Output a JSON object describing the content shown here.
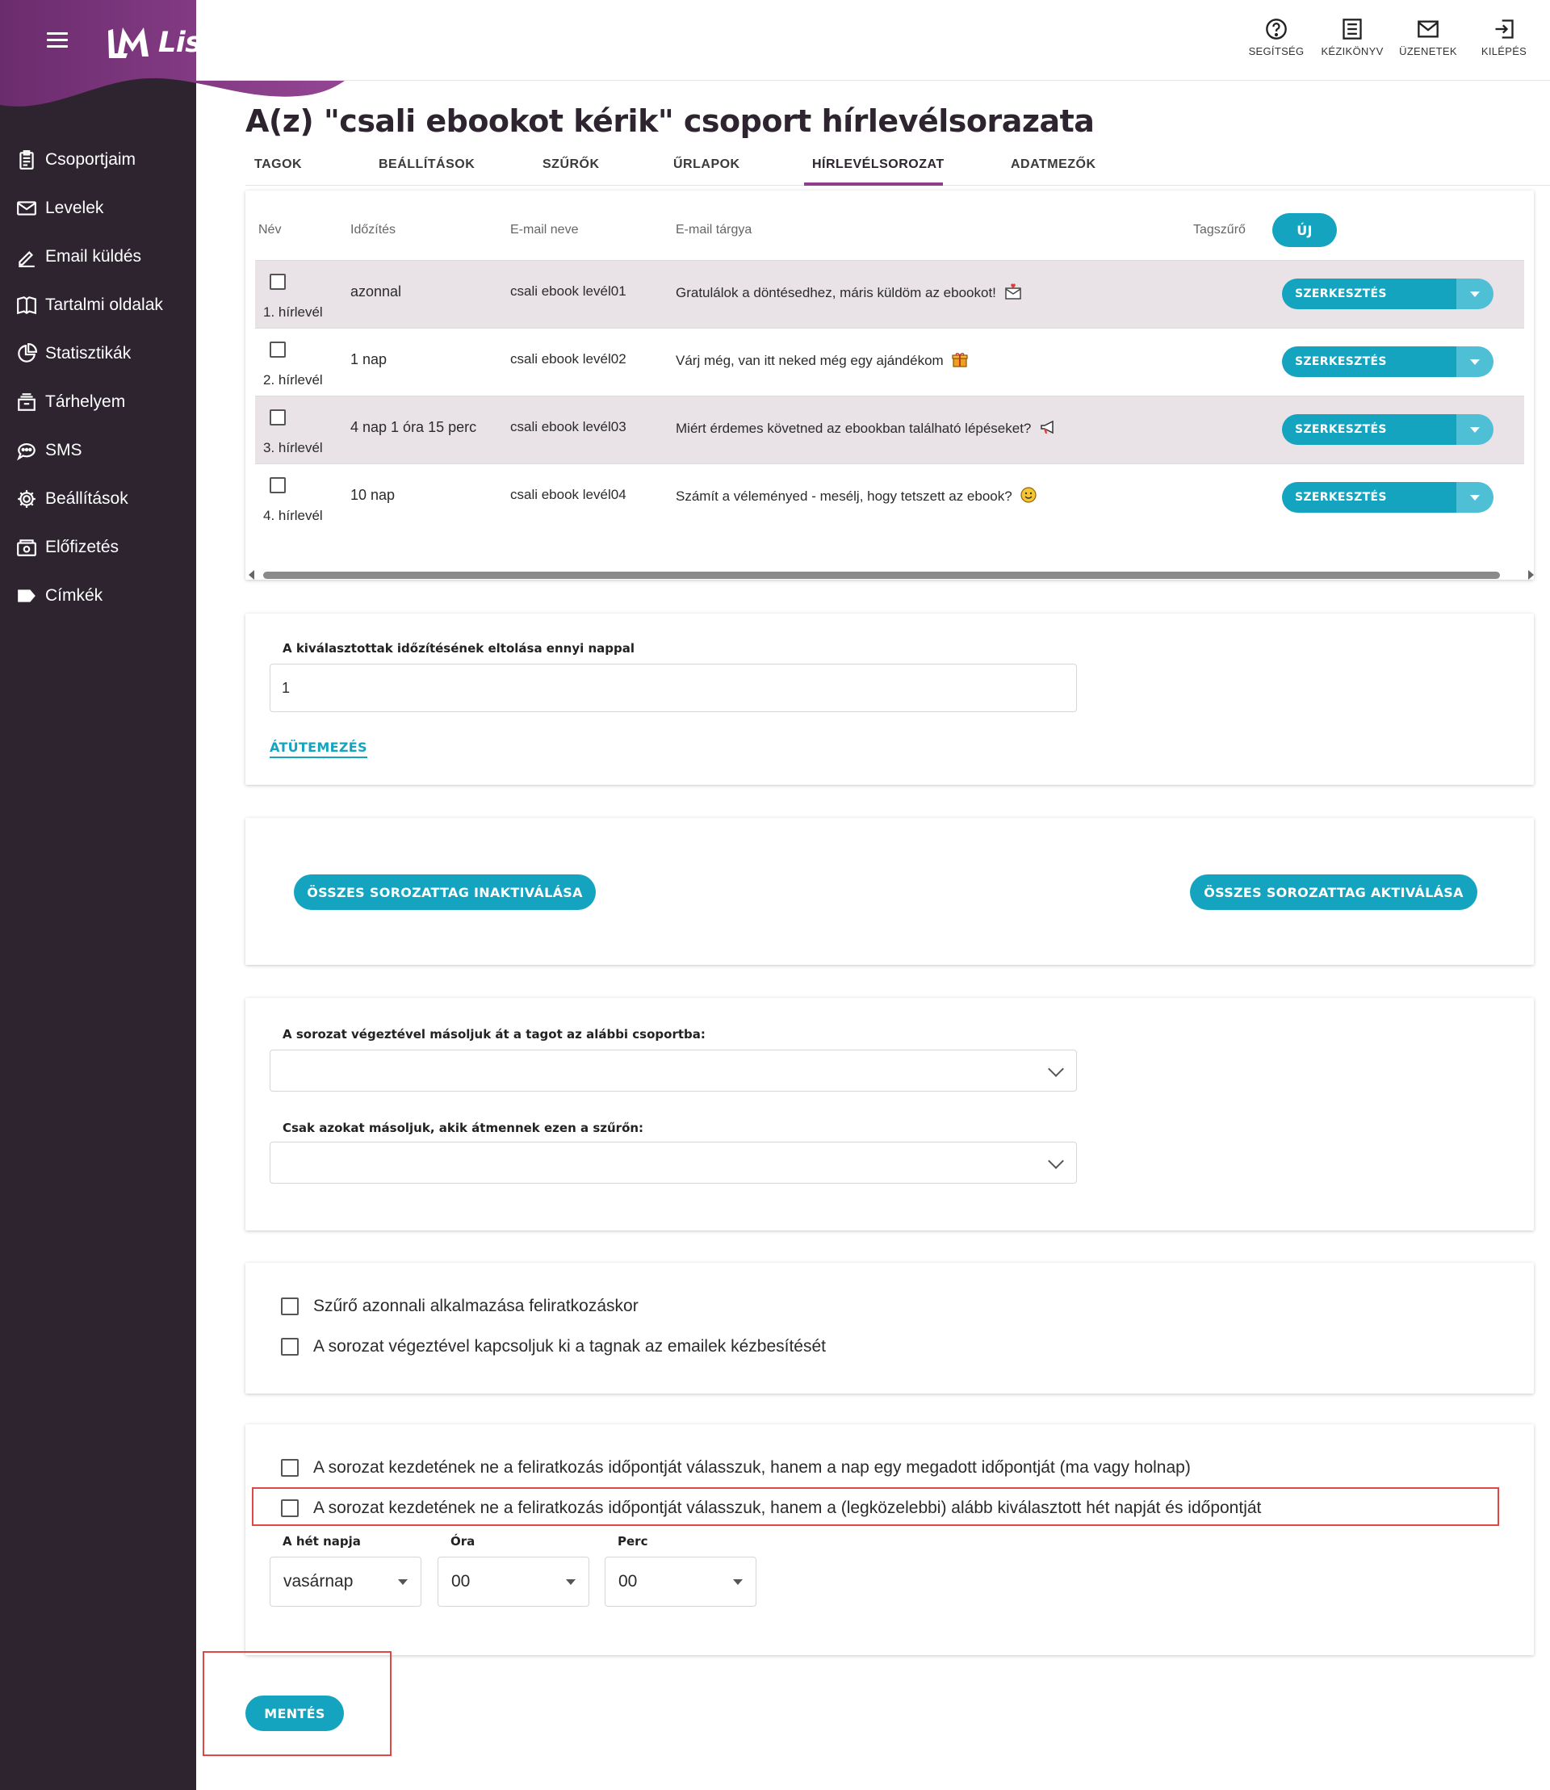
{
  "brand": {
    "name": "ListaMester",
    "accent": "#8e3f8b",
    "teal": "#14a4bf",
    "sidebar_bg": "#2d2430"
  },
  "top_actions": [
    {
      "label": "SEGÍTSÉG",
      "icon": "help-circle-icon"
    },
    {
      "label": "KÉZIKÖNYV",
      "icon": "manual-list-icon"
    },
    {
      "label": "ÜZENETEK",
      "icon": "mail-icon"
    },
    {
      "label": "KILÉPÉS",
      "icon": "logout-icon"
    }
  ],
  "sidebar": {
    "items": [
      {
        "label": "Csoportjaim",
        "icon": "clipboard-icon"
      },
      {
        "label": "Levelek",
        "icon": "envelope-icon"
      },
      {
        "label": "Email küldés",
        "icon": "pencil-icon"
      },
      {
        "label": "Tartalmi oldalak",
        "icon": "book-icon"
      },
      {
        "label": "Statisztikák",
        "icon": "pie-chart-icon"
      },
      {
        "label": "Tárhelyem",
        "icon": "storage-icon"
      },
      {
        "label": "SMS",
        "icon": "chat-icon"
      },
      {
        "label": "Beállítások",
        "icon": "gear-icon"
      },
      {
        "label": "Előfizetés",
        "icon": "wallet-icon"
      },
      {
        "label": "Címkék",
        "icon": "tag-icon"
      }
    ]
  },
  "page": {
    "title": "A(z) \"csali ebookot kérik\" csoport hírlevélsorazata"
  },
  "tabs": [
    {
      "label": "TAGOK"
    },
    {
      "label": "BEÁLLÍTÁSOK"
    },
    {
      "label": "SZŰRŐK"
    },
    {
      "label": "ŰRLAPOK"
    },
    {
      "label": "HÍRLEVÉLSOROZAT",
      "active": true
    },
    {
      "label": "ADATMEZŐK"
    }
  ],
  "table": {
    "headers": {
      "name": "Név",
      "timing": "Időzítés",
      "email_name": "E-mail neve",
      "subject": "E-mail tárgya",
      "filter": "Tagszűrő"
    },
    "new_label": "ÚJ",
    "edit_label": "SZERKESZTÉS",
    "rows": [
      {
        "name": "1. hírlevél",
        "timing": "azonnal",
        "email_name": "csali ebook levél01",
        "subject": "Gratulálok a döntésedhez, máris küldöm az ebookot!",
        "emoji": "envelope-heart-icon"
      },
      {
        "name": "2. hírlevél",
        "timing": "1 nap",
        "email_name": "csali ebook levél02",
        "subject": "Várj még, van itt neked még egy ajándékom",
        "emoji": "gift-icon"
      },
      {
        "name": "3. hírlevél",
        "timing": "4 nap 1 óra 15 perc",
        "email_name": "csali ebook levél03",
        "subject": "Miért érdemes követned az ebookban található lépéseket?",
        "emoji": "megaphone-icon"
      },
      {
        "name": "4. hírlevél",
        "timing": "10 nap",
        "email_name": "csali ebook levél04",
        "subject": "Számít a véleményed - mesélj, hogy tetszett az ebook?",
        "emoji": "smile-icon"
      }
    ]
  },
  "reschedule": {
    "label": "A kiválasztottak időzítésének eltolása ennyi nappal",
    "value": "1",
    "button": "ÁTÜTEMEZÉS"
  },
  "bulk": {
    "deactivate": "ÖSSZES SOROZATTAG INAKTIVÁLÁSA",
    "activate": "ÖSSZES SOROZATTAG AKTIVÁLÁSA"
  },
  "copy": {
    "group_label": "A sorozat végeztével másoljuk át a tagot az alábbi csoportba:",
    "group_value": "",
    "filter_label": "Csak azokat másoljuk, akik átmennek ezen a szűrőn:",
    "filter_value": ""
  },
  "options": {
    "apply_filter": "Szűrő azonnali alkalmazása feliratkozáskor",
    "disable_delivery": "A sorozat végeztével kapcsoljuk ki a tagnak az emailek kézbesítését"
  },
  "start": {
    "option_day_time": "A sorozat kezdetének ne a feliratkozás időpontját válasszuk, hanem a nap egy megadott időpontját (ma vagy holnap)",
    "option_weekday": "A sorozat kezdetének ne a feliratkozás időpontját válasszuk, hanem a (legközelebbi) alább kiválasztott hét napját és időpontját",
    "weekday_label": "A hét napja",
    "weekday_value": "vasárnap",
    "hour_label": "Óra",
    "hour_value": "00",
    "minute_label": "Perc",
    "minute_value": "00"
  },
  "save_label": "MENTÉS"
}
